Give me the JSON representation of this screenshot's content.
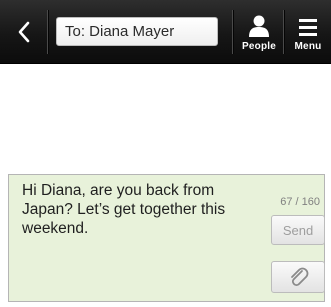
{
  "header": {
    "back_icon": "chevron-left-icon",
    "to_field": "To: Diana Mayer",
    "people": {
      "label": "People",
      "icon": "person-icon"
    },
    "menu": {
      "label": "Menu",
      "icon": "menu-icon"
    }
  },
  "compose": {
    "message": "Hi Diana, are you back from Japan? Let’s get together this weekend.",
    "counter": "67 / 160",
    "send_label": "Send",
    "attach_icon": "paperclip-icon"
  },
  "colors": {
    "topbar": "#161616",
    "compose_bg": "#e8f2da",
    "send_text": "#9e9e9e"
  }
}
